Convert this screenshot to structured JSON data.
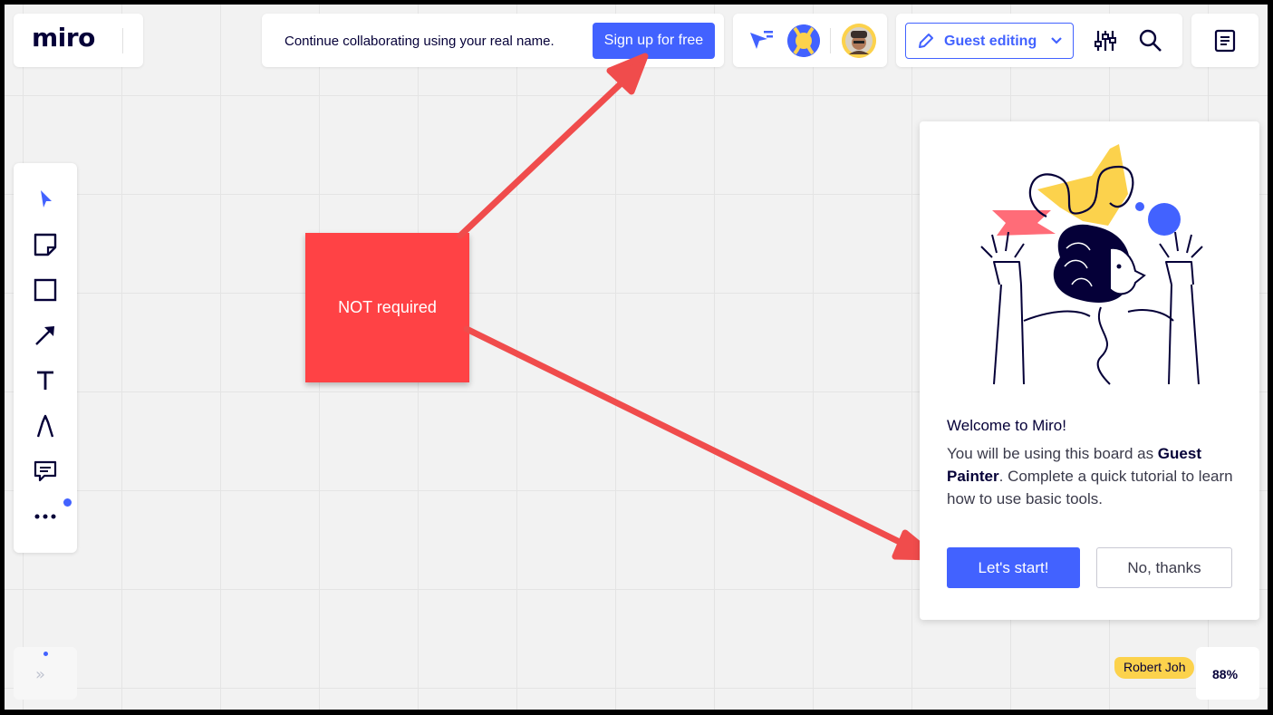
{
  "logo": {
    "text": "miro"
  },
  "signup": {
    "message": "Continue collaborating using your real name.",
    "button_label": "Sign up for free"
  },
  "top_tools": {
    "mode_label": "Guest editing",
    "icons": [
      "cursor-icon",
      "pencil-icon",
      "chevron-down-icon",
      "settings-icon",
      "search-icon",
      "notes-icon"
    ]
  },
  "toolbar": {
    "items": [
      "select-icon",
      "sticky-note-icon",
      "rectangle-icon",
      "arrow-icon",
      "text-icon",
      "pen-icon",
      "comment-icon",
      "more-icon"
    ]
  },
  "sticky_note": {
    "text": "NOT required"
  },
  "welcome": {
    "title": "Welcome to Miro!",
    "body_pre": "You will be using this board as ",
    "body_bold": "Guest Painter",
    "body_post": ". Complete a quick tutorial to learn how to use basic tools.",
    "start_label": "Let's start!",
    "decline_label": "No, thanks"
  },
  "cursor_user": {
    "name": "Robert Joh"
  },
  "zoom": {
    "value": "88%"
  },
  "colors": {
    "accent": "#4262ff",
    "sticky": "#ff4245",
    "user_label": "#fcd24c",
    "arrow": "#f04c4c"
  }
}
